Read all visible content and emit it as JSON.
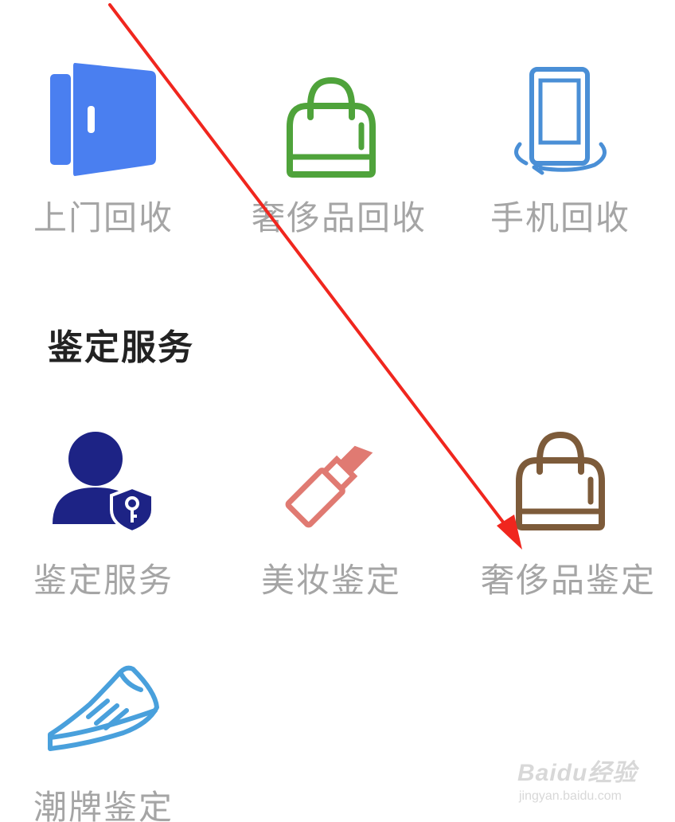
{
  "recycle": {
    "items": [
      {
        "label": "上门回收",
        "icon": "door-icon",
        "color": "#4a7ff0"
      },
      {
        "label": "奢侈品回收",
        "icon": "handbag-icon",
        "color": "#4fa33b"
      },
      {
        "label": "手机回收",
        "icon": "phone-rotate-icon",
        "color": "#4a8fd6"
      }
    ]
  },
  "appraisal": {
    "title": "鉴定服务",
    "items": [
      {
        "label": "鉴定服务",
        "icon": "user-shield-key-icon",
        "color": "#1d2385"
      },
      {
        "label": "美妆鉴定",
        "icon": "lipstick-icon",
        "color": "#e07a72"
      },
      {
        "label": "奢侈品鉴定",
        "icon": "handbag-icon",
        "color": "#7d5b3a"
      },
      {
        "label": "潮牌鉴定",
        "icon": "sneaker-icon",
        "color": "#49a0dc"
      }
    ]
  },
  "annotation": {
    "arrow_color": "#f0261e"
  },
  "watermark": {
    "main": "Baidu经验",
    "sub": "jingyan.baidu.com"
  }
}
